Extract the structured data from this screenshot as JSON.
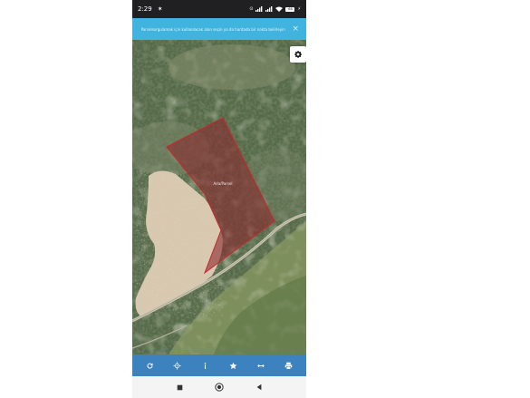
{
  "status_bar": {
    "time": "2:29",
    "battery": "68"
  },
  "banner": {
    "text": "Parselsorgulamak için kullanılacak alan seçin ya da haritada bir nokta belirleyin",
    "close_label": "×"
  },
  "map": {
    "parcel_label": "Ada/Parsel"
  },
  "toolbar": {
    "items": [
      "refresh-icon",
      "locate-icon",
      "info-icon",
      "star-icon",
      "measure-icon",
      "print-icon"
    ]
  },
  "colors": {
    "banner": "#40b4df",
    "toolbar": "#3c82bf",
    "parcel_fill": "#8b2a2f",
    "parcel_stroke": "#c8262d"
  }
}
